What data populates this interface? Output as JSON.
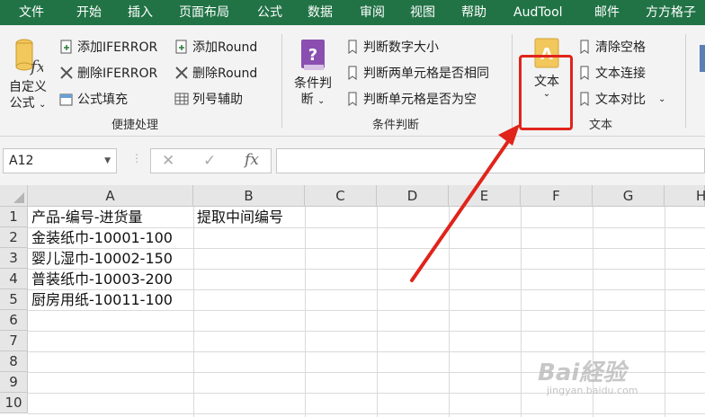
{
  "menu": [
    "文件",
    "开始",
    "插入",
    "页面布局",
    "公式",
    "数据",
    "审阅",
    "视图",
    "帮助",
    "AudTool",
    "邮件",
    "方方格子"
  ],
  "ribbon": {
    "group1": {
      "label": "便捷处理",
      "big_button": "自定义\n公式",
      "big_button_line1": "自定义",
      "big_button_line2": "公式",
      "buttons": [
        "添加IFERROR",
        "删除IFERROR",
        "公式填充",
        "添加Round",
        "删除Round",
        "列号辅助"
      ]
    },
    "group2": {
      "label": "条件判断",
      "big_button_line1": "条件判",
      "big_button_line2": "断",
      "buttons": [
        "判断数字大小",
        "判断两单元格是否相同",
        "判断单元格是否为空"
      ]
    },
    "group3": {
      "label": "文本",
      "big_button": "文本",
      "buttons": [
        "清除空格",
        "文本连接",
        "文本对比"
      ]
    }
  },
  "formula_bar": {
    "name_box": "A12",
    "formula": ""
  },
  "grid": {
    "columns": [
      "A",
      "B",
      "C",
      "D",
      "E",
      "F",
      "G",
      "H"
    ],
    "rows": [
      "1",
      "2",
      "3",
      "4",
      "5",
      "6",
      "7",
      "8",
      "9",
      "10"
    ],
    "cells": {
      "A1": "产品-编号-进货量",
      "B1": "提取中间编号",
      "A2": "金装纸巾-10001-100",
      "A3": "婴儿湿巾-10002-150",
      "A4": "普装纸巾-10003-200",
      "A5": "厨房用纸-10011-100"
    }
  },
  "watermark": {
    "main": "Bai経验",
    "sub": "jingyan.baidu.com"
  },
  "colors": {
    "accent": "#217346",
    "highlight": "#e0241b"
  }
}
